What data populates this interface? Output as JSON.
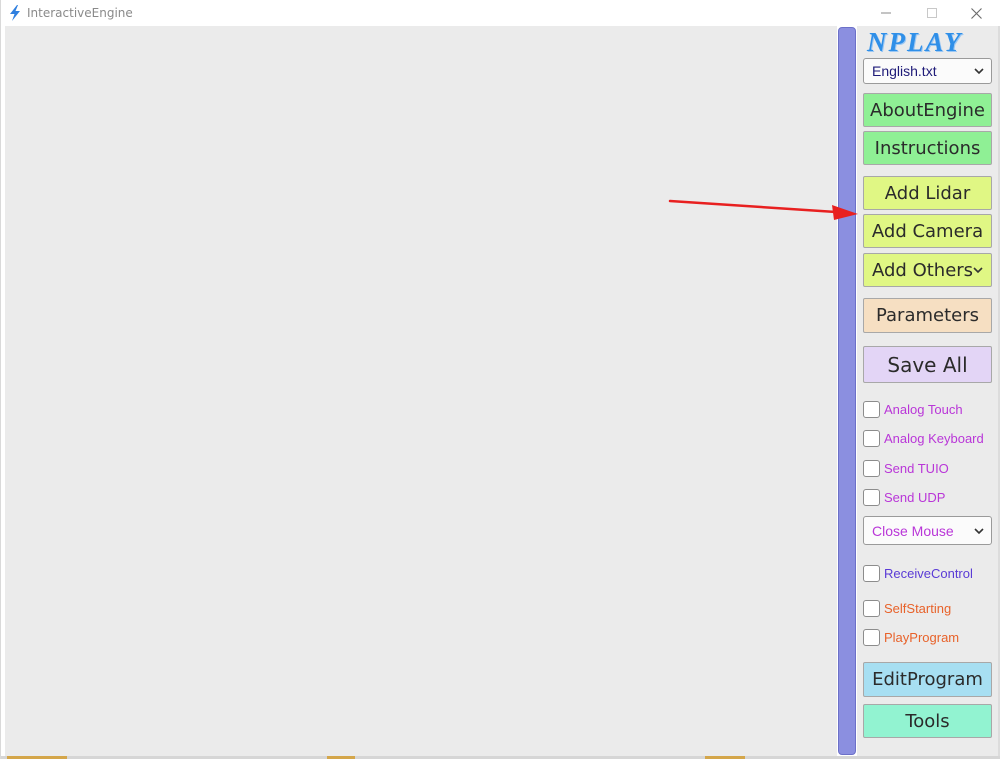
{
  "window": {
    "title": "InteractiveEngine"
  },
  "panel": {
    "logo": "NPLAY",
    "language_select": {
      "value": "English.txt"
    },
    "buttons": {
      "about_engine": "AboutEngine",
      "instructions": "Instructions",
      "add_lidar": "Add Lidar",
      "add_camera": "Add Camera",
      "add_others": "Add Others",
      "parameters": "Parameters",
      "save_all": "Save All",
      "edit_program": "EditProgram",
      "tools": "Tools"
    },
    "checkboxes": {
      "analog_touch": "Analog Touch",
      "analog_keyboard": "Analog Keyboard",
      "send_tuio": "Send TUIO",
      "send_udp": "Send UDP",
      "receive_control": "ReceiveControl",
      "self_starting": "SelfStarting",
      "play_program": "PlayProgram"
    },
    "mouse_select": {
      "value": "Close Mouse"
    }
  },
  "colors": {
    "accent_purple": "#b936d8",
    "receive_blue": "#5a3bd6",
    "orange": "#e8622a",
    "logo_blue": "#2f8fe8",
    "annotation_red": "#e82020"
  },
  "icons": {
    "app": "lightning-bolt-icon",
    "dropdown": "chevron-down-icon"
  }
}
